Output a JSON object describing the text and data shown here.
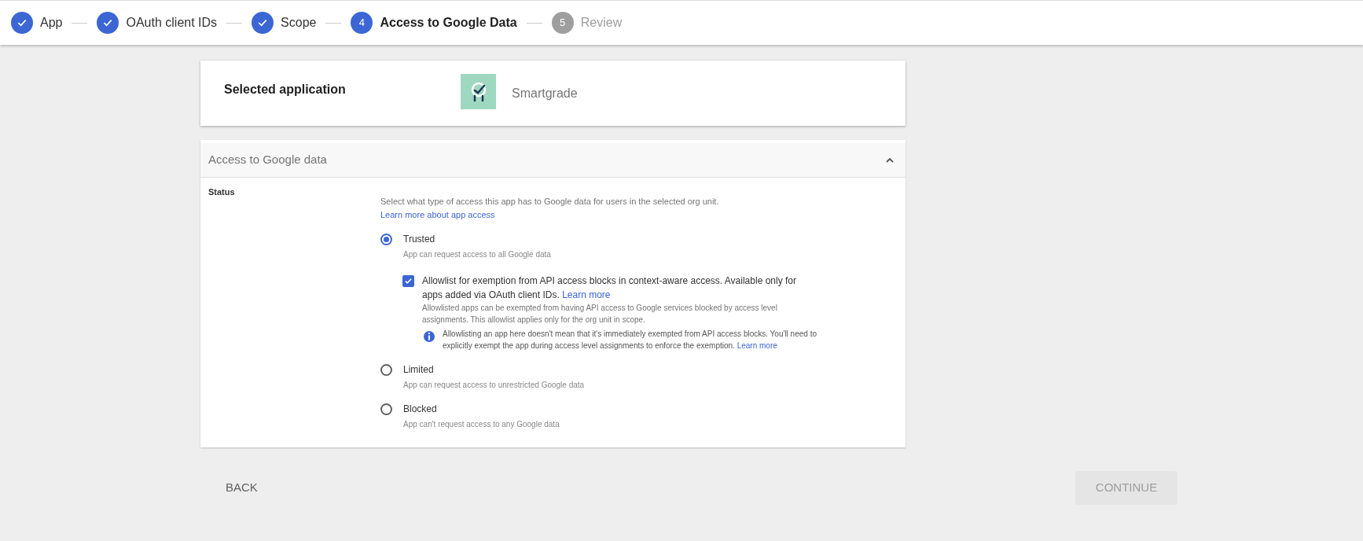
{
  "stepper": [
    {
      "label": "App",
      "kind": "done"
    },
    {
      "label": "OAuth client IDs",
      "kind": "done"
    },
    {
      "label": "Scope",
      "kind": "done"
    },
    {
      "label": "Access to Google Data",
      "kind": "active",
      "number": "4"
    },
    {
      "label": "Review",
      "kind": "pending",
      "number": "5"
    }
  ],
  "selected_application": {
    "label": "Selected application",
    "app_name": "Smartgrade"
  },
  "access_panel": {
    "title": "Access to Google data",
    "expanded": true,
    "field_label": "Status",
    "description": "Select what type of access this app has to Google data for users in the selected org unit.",
    "learn_more_link": "Learn more about app access",
    "options": [
      {
        "label": "Trusted",
        "description": "App can request access to all Google data",
        "selected": true,
        "allowlist": {
          "checked": true,
          "label": "Allowlist for exemption from API access blocks in context-aware access. Available only for apps added via OAuth client IDs.",
          "link": "Learn more",
          "description": "Allowlisted apps can be exempted from having API access to Google services blocked by access level assignments. This allowlist applies only for the org unit in scope.",
          "info": "Allowlisting an app here doesn't mean that it's immediately exempted from API access blocks. You'll need to explicitly exempt the app during access level assignments to enforce the exemption.",
          "info_link": "Learn more"
        }
      },
      {
        "label": "Limited",
        "description": "App can request access to unrestricted Google data",
        "selected": false
      },
      {
        "label": "Blocked",
        "description": "App can't request access to any Google data",
        "selected": false
      }
    ]
  },
  "buttons": {
    "back": "BACK",
    "continue": {
      "label": "CONTINUE",
      "disabled": true
    }
  }
}
